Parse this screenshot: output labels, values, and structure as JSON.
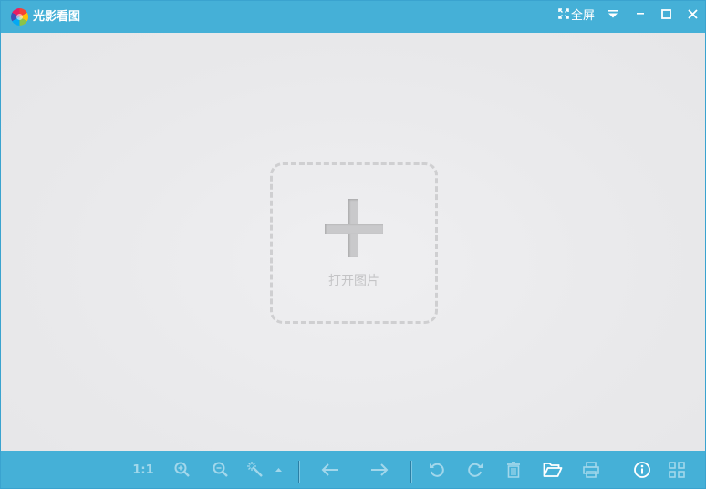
{
  "app": {
    "title": "光影看图",
    "fullscreen_label": "全屏"
  },
  "viewer": {
    "open_label": "打开图片"
  },
  "toolbar": {
    "ratio_label": "1:1",
    "items": [
      "actual-size",
      "zoom-in",
      "zoom-out",
      "auto-enhance",
      "previous",
      "next",
      "rotate-left",
      "rotate-right",
      "delete",
      "open-folder",
      "print",
      "info",
      "thumbnails"
    ]
  },
  "colors": {
    "accent": "#45b0d7",
    "background": "#ebebed",
    "placeholder": "#c9c9cb"
  }
}
